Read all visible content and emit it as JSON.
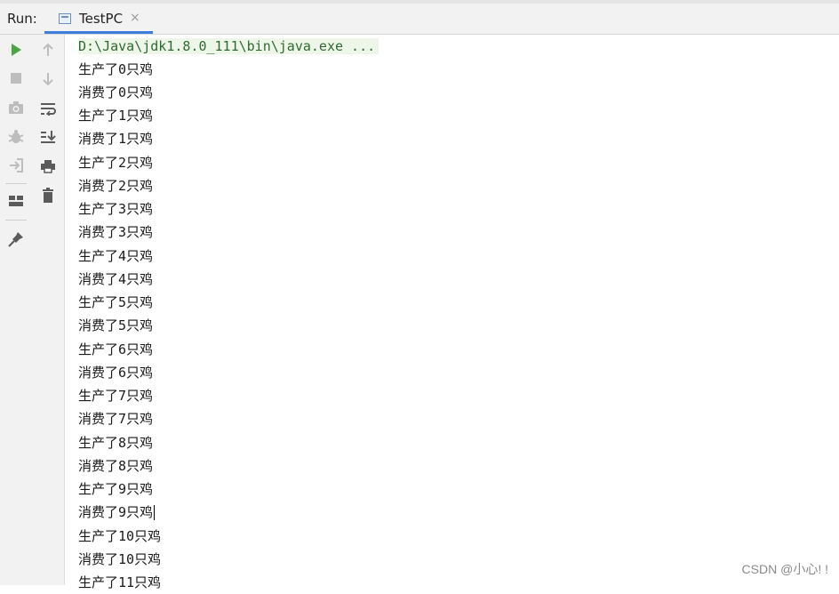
{
  "panel": {
    "run_label": "Run:"
  },
  "tab": {
    "label": "TestPC",
    "close_glyph": "×"
  },
  "toolbar_left": [
    {
      "name": "run-icon",
      "glyph": "play",
      "color": "#4aa542"
    },
    {
      "name": "stop-icon",
      "glyph": "stop",
      "color": "#bdbdbd"
    },
    {
      "name": "camera-icon",
      "glyph": "camera",
      "color": "#bdbdbd"
    },
    {
      "name": "debug-bug-icon",
      "glyph": "bug",
      "color": "#bdbdbd"
    },
    {
      "name": "login-arrow-icon",
      "glyph": "login",
      "color": "#bdbdbd"
    },
    {
      "name": "layout-icon",
      "glyph": "layout",
      "color": "#5b5b5b"
    },
    {
      "name": "pin-icon",
      "glyph": "pin",
      "color": "#5b5b5b"
    }
  ],
  "toolbar_right": [
    {
      "name": "up-arrow-icon",
      "glyph": "up",
      "color": "#bdbdbd"
    },
    {
      "name": "down-arrow-icon",
      "glyph": "down",
      "color": "#bdbdbd"
    },
    {
      "name": "soft-wrap-icon",
      "glyph": "wrap",
      "color": "#5b5b5b"
    },
    {
      "name": "scroll-to-end-icon",
      "glyph": "scrollend",
      "color": "#5b5b5b"
    },
    {
      "name": "print-icon",
      "glyph": "print",
      "color": "#5b5b5b"
    },
    {
      "name": "trash-icon",
      "glyph": "trash",
      "color": "#5b5b5b"
    }
  ],
  "console": {
    "command": "D:\\Java\\jdk1.8.0_111\\bin\\java.exe ...",
    "lines": [
      "生产了0只鸡",
      "消费了0只鸡",
      "生产了1只鸡",
      "消费了1只鸡",
      "生产了2只鸡",
      "消费了2只鸡",
      "生产了3只鸡",
      "消费了3只鸡",
      "生产了4只鸡",
      "消费了4只鸡",
      "生产了5只鸡",
      "消费了5只鸡",
      "生产了6只鸡",
      "消费了6只鸡",
      "生产了7只鸡",
      "消费了7只鸡",
      "生产了8只鸡",
      "消费了8只鸡",
      "生产了9只鸡",
      "消费了9只鸡",
      "生产了10只鸡",
      "消费了10只鸡",
      "生产了11只鸡"
    ]
  },
  "watermark": "CSDN @小心! !"
}
